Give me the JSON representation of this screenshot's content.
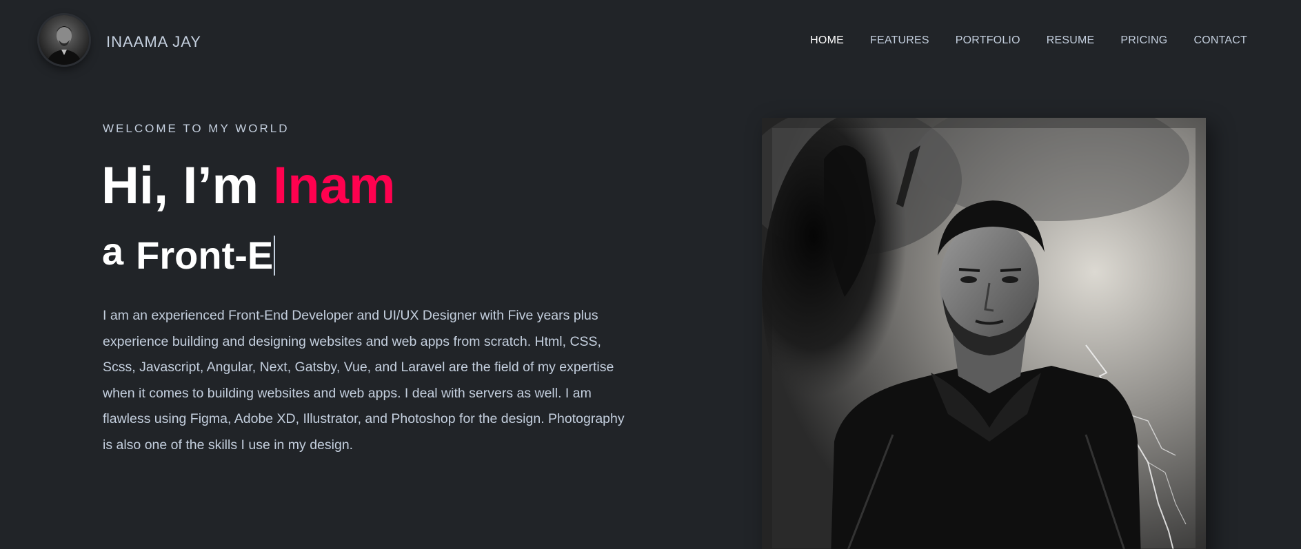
{
  "header": {
    "brand": "INAAMA JAY",
    "avatar_icon": "profile-photo-avatar",
    "nav": [
      {
        "label": "HOME",
        "active": true
      },
      {
        "label": "FEATURES",
        "active": false
      },
      {
        "label": "PORTFOLIO",
        "active": false
      },
      {
        "label": "RESUME",
        "active": false
      },
      {
        "label": "PRICING",
        "active": false
      },
      {
        "label": "CONTACT",
        "active": false
      }
    ]
  },
  "hero": {
    "welcome": "WELCOME TO MY WORLD",
    "greeting": "Hi, I’m ",
    "name": "Inam",
    "role_prefix": "a",
    "role_typed": "Front-E",
    "bio": "I am an experienced Front-End Developer and UI/UX Designer with Five years plus experience building and designing websites and web apps from scratch. Html, CSS, Scss, Javascript, Angular, Next, Gatsby, Vue, and Laravel are the field of my expertise when it comes to building websites and web apps. I deal with servers as well. I am flawless using Figma, Adobe XD, Illustrator, and Photoshop for the design. Photography is also one of the skills I use in my design."
  },
  "colors": {
    "background": "#212428",
    "accent": "#ff014f",
    "text": "#c4cfde",
    "heading": "#ffffff"
  }
}
